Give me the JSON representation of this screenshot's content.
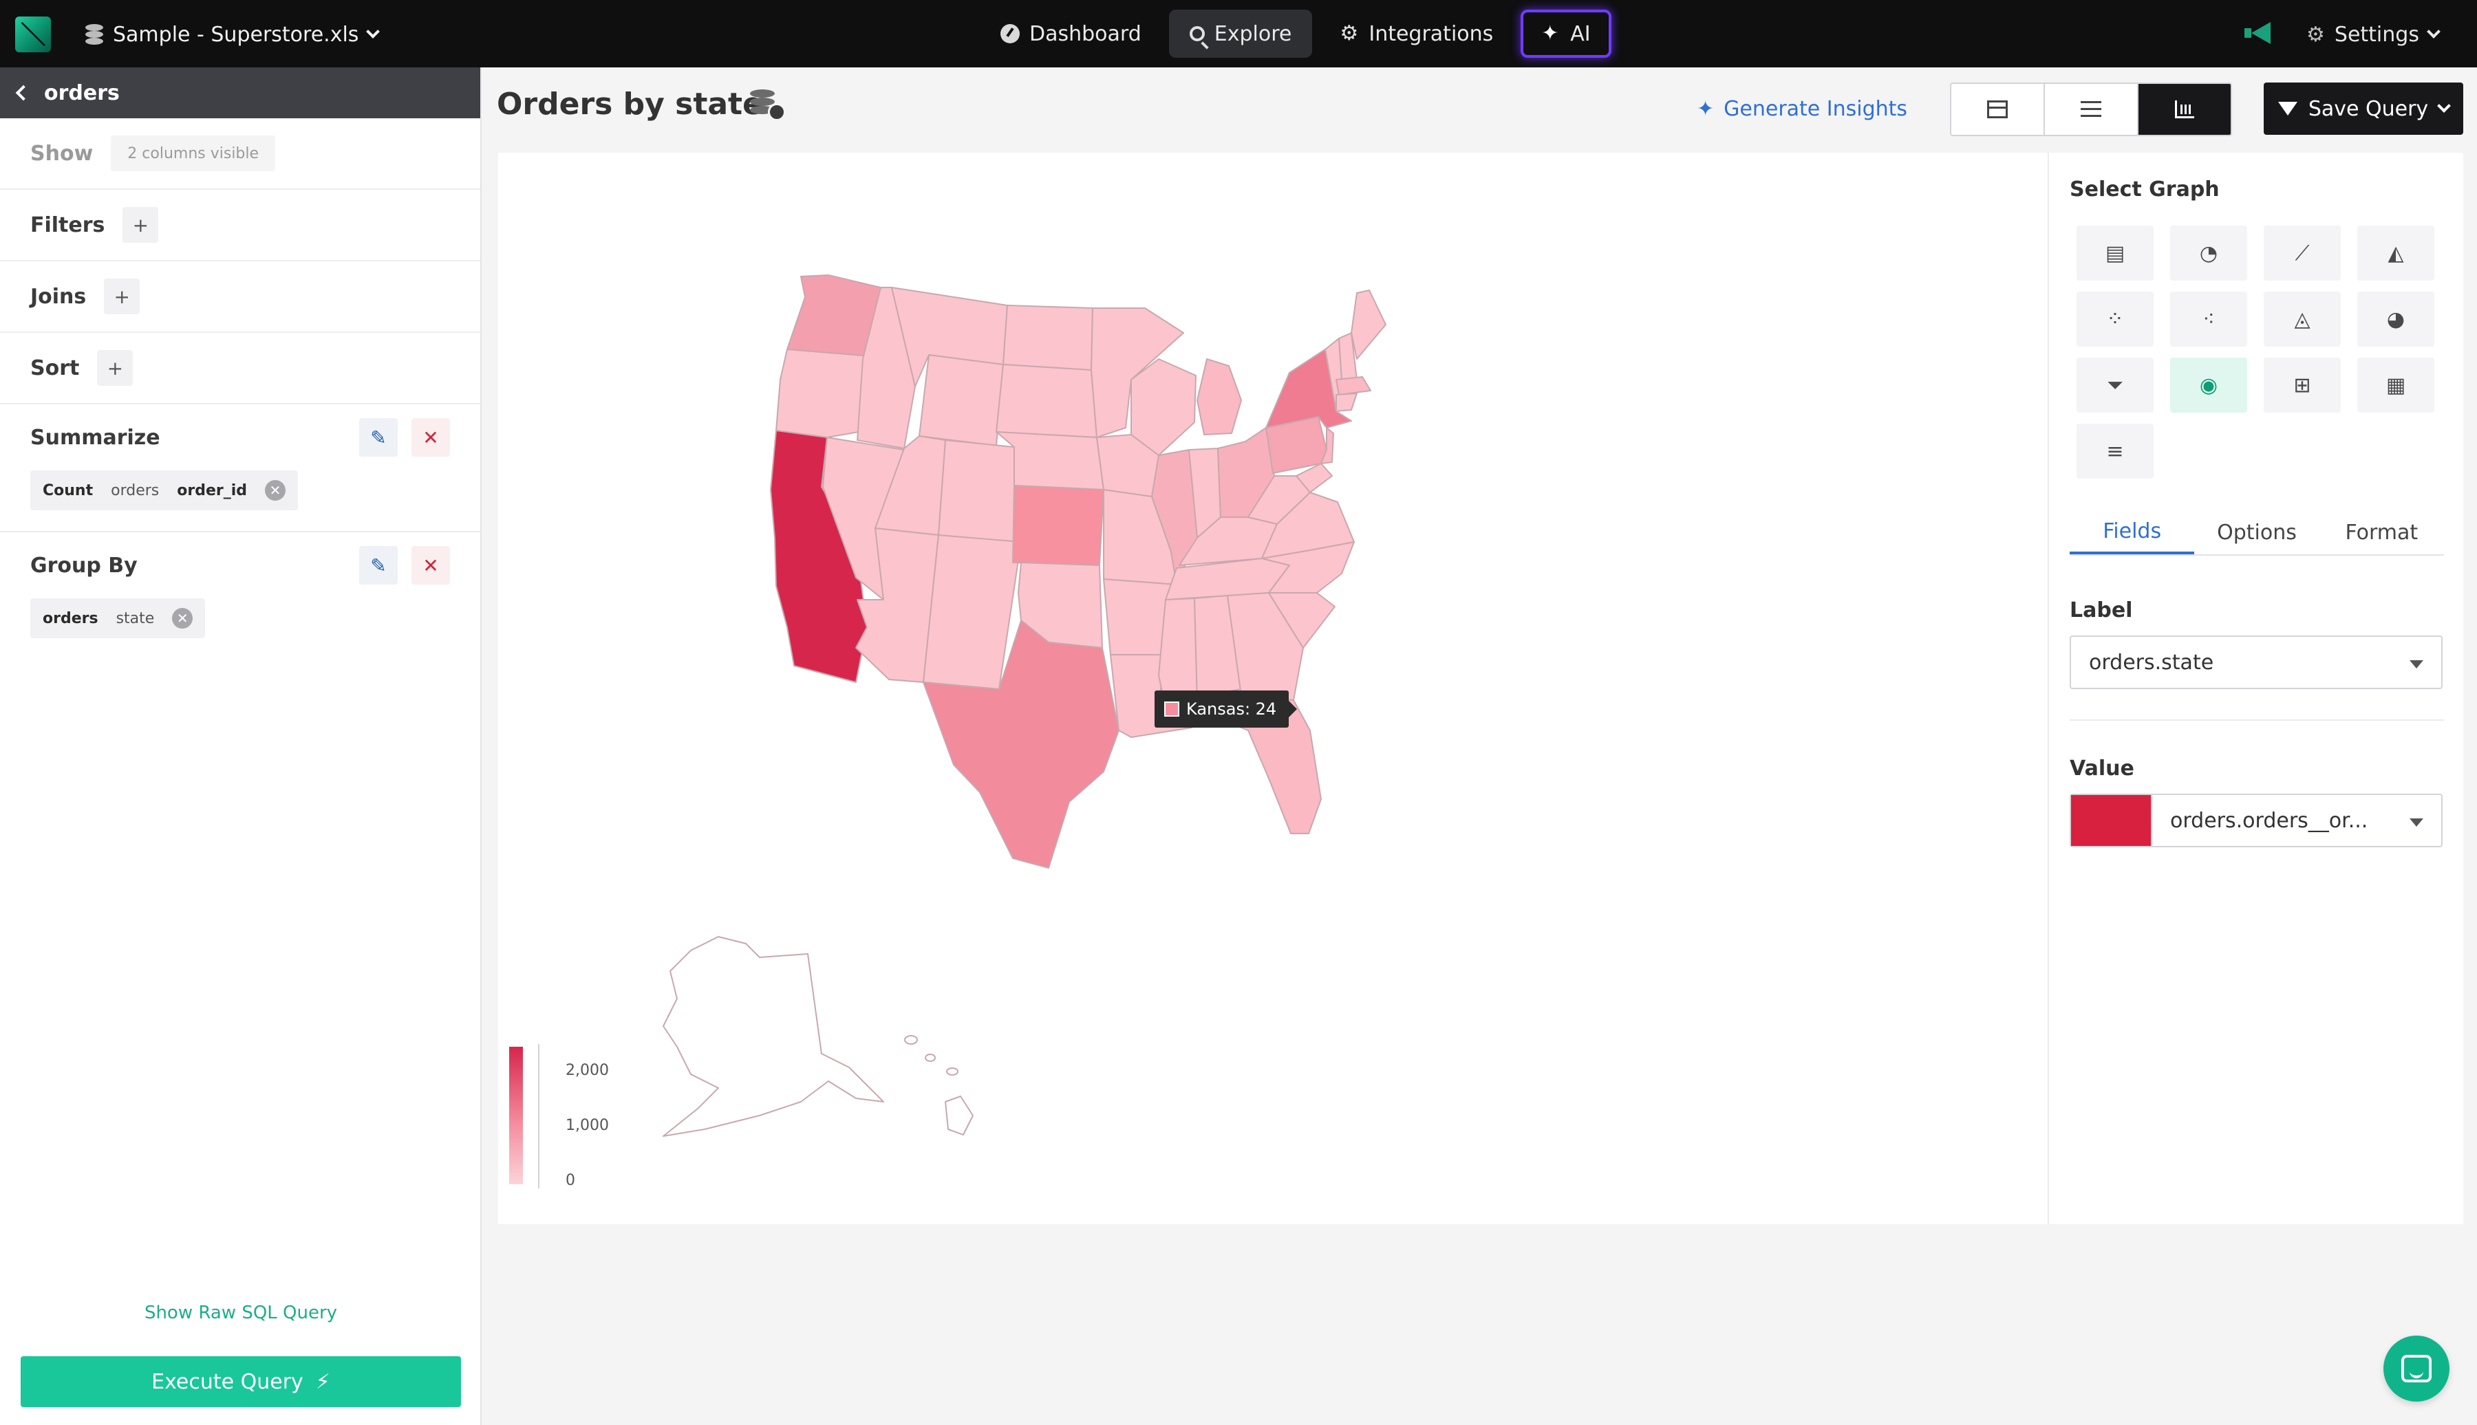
{
  "topnav": {
    "datasource": "Sample - Superstore.xls",
    "nav": [
      {
        "label": "Dashboard",
        "icon": "dashboard-icon"
      },
      {
        "label": "Explore",
        "icon": "search-icon",
        "active": true
      },
      {
        "label": "Integrations",
        "icon": "gears-icon"
      },
      {
        "label": "AI",
        "icon": "sparkle-icon"
      }
    ],
    "settings": "Settings"
  },
  "left": {
    "table": "orders",
    "show_label": "Show",
    "columns_visible": "2 columns visible",
    "filters_label": "Filters",
    "joins_label": "Joins",
    "sort_label": "Sort",
    "plus": "+",
    "summarize": {
      "label": "Summarize",
      "chip": {
        "agg": "Count",
        "table": "orders",
        "column": "order_id"
      }
    },
    "group_by": {
      "label": "Group By",
      "chip": {
        "table": "orders",
        "column": "state"
      }
    },
    "raw_sql": "Show Raw SQL Query",
    "execute": "Execute Query"
  },
  "header": {
    "title": "Orders by state",
    "generate_insights": "Generate Insights",
    "save_query": "Save Query"
  },
  "config": {
    "select_graph": "Select Graph",
    "graph_types": [
      "bar-chart-icon",
      "pie-chart-icon",
      "line-chart-icon",
      "area-chart-icon",
      "scatter-chart-icon",
      "bubble-chart-icon",
      "radar-chart-icon",
      "sunburst-chart-icon",
      "funnel-chart-icon",
      "map-chart-icon",
      "boxplot-chart-icon",
      "pivot-chart-icon",
      "sankey-chart-icon"
    ],
    "selected_graph": "map-chart-icon",
    "tabs": [
      "Fields",
      "Options",
      "Format"
    ],
    "active_tab": "Fields",
    "label_title": "Label",
    "label_value": "orders.state",
    "value_title": "Value",
    "value_value": "orders.orders__or...",
    "value_color": "#d7213f"
  },
  "tooltip": "Kansas: 24",
  "chart_data": {
    "type": "choropleth",
    "title": "",
    "legend": {
      "ticks": [
        "2,000",
        "1,000",
        "0"
      ],
      "position": "bottom-left"
    },
    "colors": {
      "low": "#fcd3da",
      "high": "#d7264c"
    },
    "values": [
      {
        "state": "California",
        "value": 2001
      },
      {
        "state": "New York",
        "value": 1128
      },
      {
        "state": "Texas",
        "value": 985
      },
      {
        "state": "Pennsylvania",
        "value": 587
      },
      {
        "state": "Washington",
        "value": 506
      },
      {
        "state": "Illinois",
        "value": 492
      },
      {
        "state": "Ohio",
        "value": 469
      },
      {
        "state": "Florida",
        "value": 383
      },
      {
        "state": "Michigan",
        "value": 255
      },
      {
        "state": "Kansas",
        "value": 24
      }
    ]
  }
}
